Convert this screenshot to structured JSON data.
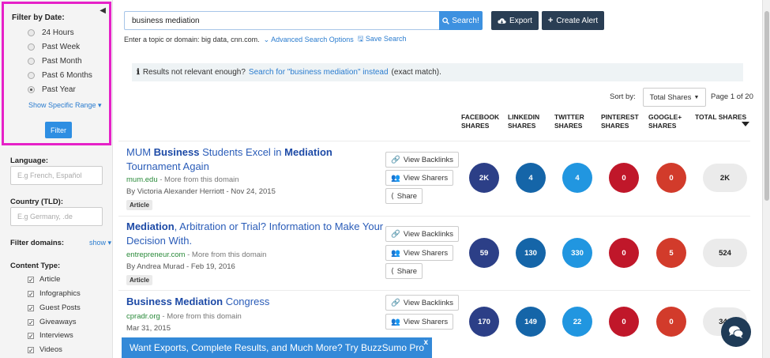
{
  "sidebar": {
    "date_title": "Filter by Date:",
    "date_options": [
      "24 Hours",
      "Past Week",
      "Past Month",
      "Past 6 Months",
      "Past Year"
    ],
    "selected_date": "Past Year",
    "range_link": "Show Specific Range ▾",
    "filter_button": "Filter",
    "language_label": "Language:",
    "language_placeholder": "E.g French, Español",
    "country_label": "Country (TLD):",
    "country_placeholder": "E.g Germany, .de",
    "domains_label": "Filter domains:",
    "domains_show": "show ▾",
    "content_type_label": "Content Type:",
    "content_types": [
      "Article",
      "Infographics",
      "Guest Posts",
      "Giveaways",
      "Interviews",
      "Videos"
    ]
  },
  "toolbar": {
    "search_value": "business mediation",
    "search_button": "Search!",
    "export_button": "Export",
    "alert_button": "Create Alert",
    "hint_text": "Enter a topic or domain: big data, cnn.com.",
    "advanced_link": "Advanced Search Options",
    "save_link": "Save Search"
  },
  "notice": {
    "prefix": "Results not relevant enough?",
    "link": "Search for \"business mediation\" instead",
    "suffix": "(exact match)."
  },
  "sort": {
    "label": "Sort by:",
    "selected": "Total Shares",
    "page": "Page 1 of 20"
  },
  "columns": [
    {
      "line1": "FACEBOOK",
      "line2": "SHARES"
    },
    {
      "line1": "LINKEDIN",
      "line2": "SHARES"
    },
    {
      "line1": "TWITTER",
      "line2": "SHARES"
    },
    {
      "line1": "PINTEREST",
      "line2": "SHARES"
    },
    {
      "line1": "GOOGLE+",
      "line2": "SHARES"
    },
    {
      "line1": "TOTAL SHARES",
      "line2": ""
    }
  ],
  "actions": {
    "backlinks": "View Backlinks",
    "sharers": "View Sharers",
    "share": "Share"
  },
  "results": [
    {
      "title_parts": [
        [
          "MUM ",
          false
        ],
        [
          "Business",
          true
        ],
        [
          " Students Excel in ",
          false
        ],
        [
          "Mediation",
          true
        ],
        [
          " Tournament Again",
          false
        ]
      ],
      "domain": "mum.edu",
      "more": " - More from this domain",
      "byline": "By Victoria Alexander Herriott - Nov 24, 2015",
      "tag": "Article",
      "facebook": "2K",
      "linkedin": "4",
      "twitter": "4",
      "pinterest": "0",
      "google": "0",
      "total": "2K"
    },
    {
      "title_parts": [
        [
          "Mediation",
          true
        ],
        [
          ", Arbitration or Trial? Information to Make Your Decision With.",
          false
        ]
      ],
      "domain": "entrepreneur.com",
      "more": " - More from this domain",
      "byline": "By Andrea Murad - Feb 19, 2016",
      "tag": "Article",
      "facebook": "59",
      "linkedin": "130",
      "twitter": "330",
      "pinterest": "0",
      "google": "5",
      "total": "524"
    },
    {
      "title_parts": [
        [
          "Business Mediation",
          true
        ],
        [
          " Congress",
          false
        ]
      ],
      "domain": "cpradr.org",
      "more": " - More from this domain",
      "byline": "Mar 31, 2015",
      "tag": "",
      "facebook": "170",
      "linkedin": "149",
      "twitter": "22",
      "pinterest": "0",
      "google": "0",
      "total": "340"
    }
  ],
  "colors": {
    "facebook": "#2c3f87",
    "linkedin": "#1565a8",
    "twitter": "#2196e0",
    "pinterest": "#c0172a",
    "google": "#d23b2b",
    "accent": "#3d91e0",
    "highlight_border": "#e621c8"
  },
  "banner": {
    "text": "Want Exports, Complete Results, and Much More? Try BuzzSumo Pro",
    "close": "x"
  }
}
